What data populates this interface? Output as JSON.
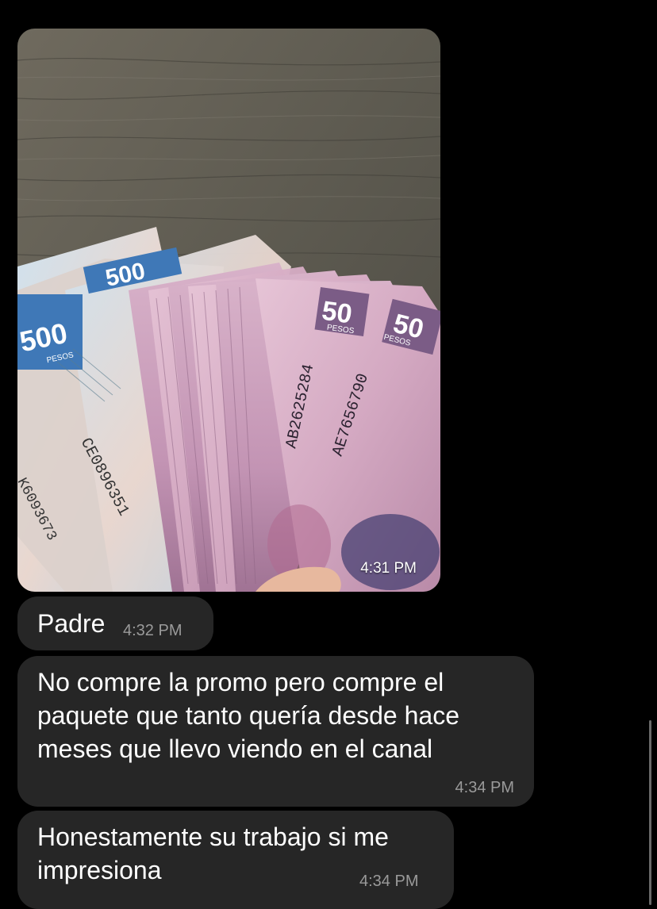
{
  "messages": [
    {
      "type": "image",
      "image_description": "hand holding a fan of Mexican 500 and 50 peso banknotes over a wooden table",
      "banknotes": {
        "d500": "500",
        "d50": "50",
        "currency": "PESOS",
        "serial_1": "AB2625284",
        "serial_2": "AE7656790",
        "serial_3": "CE0896351",
        "serial_4": "K6093673"
      },
      "time": "4:31 PM"
    },
    {
      "type": "text",
      "text": "Padre",
      "time": "4:32 PM"
    },
    {
      "type": "text",
      "text": "No compre la promo pero compre el paquete que tanto quería desde hace meses que llevo viendo en el canal",
      "time": "4:34 PM"
    },
    {
      "type": "text",
      "text": "Honestamente su trabajo si me impresiona",
      "time": "4:34 PM"
    }
  ],
  "colors": {
    "background": "#000000",
    "bubble": "#262626",
    "text": "#ffffff",
    "time": "#9a9a9a"
  }
}
